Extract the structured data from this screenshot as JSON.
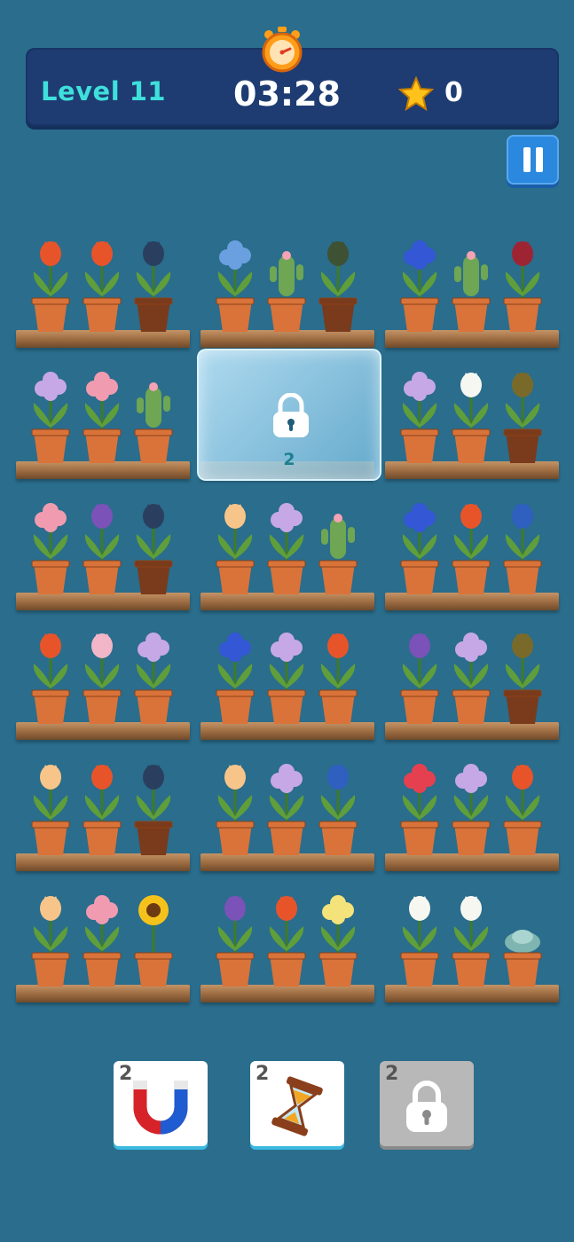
{
  "hud": {
    "level_label": "Level 11",
    "timer": "03:28",
    "stars": "0"
  },
  "frozen_tile": {
    "unlock_count": "2"
  },
  "shelves": [
    {
      "slots": [
        "tulip-red",
        "tulip-red",
        "tulip-dark"
      ]
    },
    {
      "slots": [
        "hydrangea-blue",
        "cactus",
        "herb-dark"
      ]
    },
    {
      "slots": [
        "morning-glory",
        "cactus",
        "rose-dark-red"
      ]
    },
    {
      "slots": [
        "orchid-purple",
        "hydrangea-pink",
        "cactus"
      ]
    },
    {
      "slots": [
        "hidden",
        "hidden",
        "hidden"
      ]
    },
    {
      "slots": [
        "orchid-purple",
        "peony-white",
        "tulip-olive"
      ]
    },
    {
      "slots": [
        "hydrangea-pink",
        "dahlia-purple",
        "tulip-dark"
      ]
    },
    {
      "slots": [
        "rose-peach",
        "orchid-purple",
        "cactus"
      ]
    },
    {
      "slots": [
        "morning-glory",
        "tulip-red",
        "tulip-blue"
      ]
    },
    {
      "slots": [
        "tulip-red",
        "peony-pink",
        "orchid-purple"
      ]
    },
    {
      "slots": [
        "morning-glory",
        "orchid-purple",
        "tulip-red"
      ]
    },
    {
      "slots": [
        "dahlia-purple",
        "orchid-purple",
        "tulip-olive"
      ]
    },
    {
      "slots": [
        "rose-peach",
        "tulip-red",
        "tulip-dark"
      ]
    },
    {
      "slots": [
        "rose-peach",
        "orchid-purple",
        "tulip-blue"
      ]
    },
    {
      "slots": [
        "carnation-red",
        "orchid-purple",
        "tulip-red"
      ]
    },
    {
      "slots": [
        "rose-peach",
        "hydrangea-pink",
        "sunflower"
      ]
    },
    {
      "slots": [
        "dahlia-purple",
        "tulip-red",
        "primrose-yellow"
      ]
    },
    {
      "slots": [
        "peony-white",
        "peony-white",
        "succulent"
      ]
    }
  ],
  "boosters": [
    {
      "icon": "magnet-icon",
      "count": "2"
    },
    {
      "icon": "hourglass-icon",
      "count": "2"
    },
    {
      "icon": "lock-icon",
      "count": "2"
    }
  ],
  "colors": {
    "background": "#2a6d8c",
    "hud": "#1e3c72",
    "level_text": "#3fe0dc",
    "pause": "#2a88df"
  }
}
